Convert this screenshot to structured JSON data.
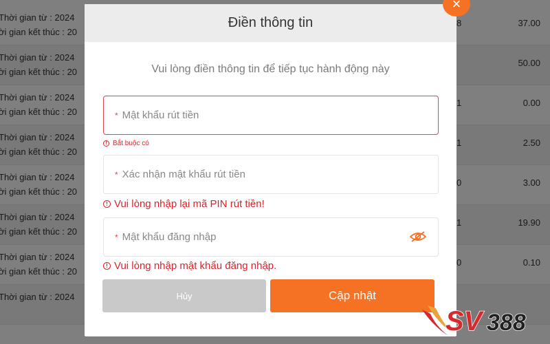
{
  "background": {
    "rows": [
      {
        "time_from": "Thời gian từ : 2024",
        "time_end": "ời gian kết thúc : 20",
        "col2": "8",
        "amount": "37.00"
      },
      {
        "time_from": "Thời gian từ : 2024",
        "time_end": "ời gian kết thúc : 20",
        "col2": "",
        "amount": "50.00"
      },
      {
        "time_from": "Thời gian từ : 2024",
        "time_end": "ời gian kết thúc : 20",
        "col2": "1",
        "amount": "0.00"
      },
      {
        "time_from": "Thời gian từ : 2024",
        "time_end": "ời gian kết thúc : 20",
        "col2": "1",
        "amount": "2.50"
      },
      {
        "time_from": "Thời gian từ : 2024",
        "time_end": "ời gian kết thúc : 20",
        "col2": "0",
        "amount": "3.00"
      },
      {
        "time_from": "Thời gian từ : 2024",
        "time_end": "ời gian kết thúc : 20",
        "col2": "1",
        "amount": "19.90"
      },
      {
        "time_from": "Thời gian từ : 2024",
        "time_end": "ời gian kết thúc : 20",
        "col2": "0",
        "amount": "0.10"
      },
      {
        "time_from": "Thời gian từ : 2024",
        "time_end": "",
        "col2": "",
        "amount": ""
      }
    ]
  },
  "modal": {
    "title": "Điền thông tin",
    "close_icon": "×",
    "subtitle": "Vui lòng điền thông tin để tiếp tục hành động này",
    "fields": [
      {
        "required_mark": "*",
        "placeholder": "Mật khẩu rút tiền",
        "error_icon": "!",
        "error": "Bắt buộc có"
      },
      {
        "required_mark": "*",
        "placeholder": "Xác nhận mật khẩu rút tiền",
        "error_icon": "!",
        "error": "Vui lòng nhập lại mã PIN rút tiền!"
      },
      {
        "required_mark": "*",
        "placeholder": "Mật khẩu đăng nhập",
        "error_icon": "!",
        "error": "Vui lòng nhập mật khẩu đăng nhập.",
        "icon": "eye-icon"
      }
    ],
    "buttons": {
      "cancel": "Hủy",
      "update": "Cập nhật"
    }
  },
  "logo": {
    "text_sv": "SV",
    "text_num": "388"
  },
  "colors": {
    "accent": "#f57224",
    "error": "#d9242c",
    "cancel": "#c9c9c9",
    "logo_red": "#d52b2f"
  }
}
